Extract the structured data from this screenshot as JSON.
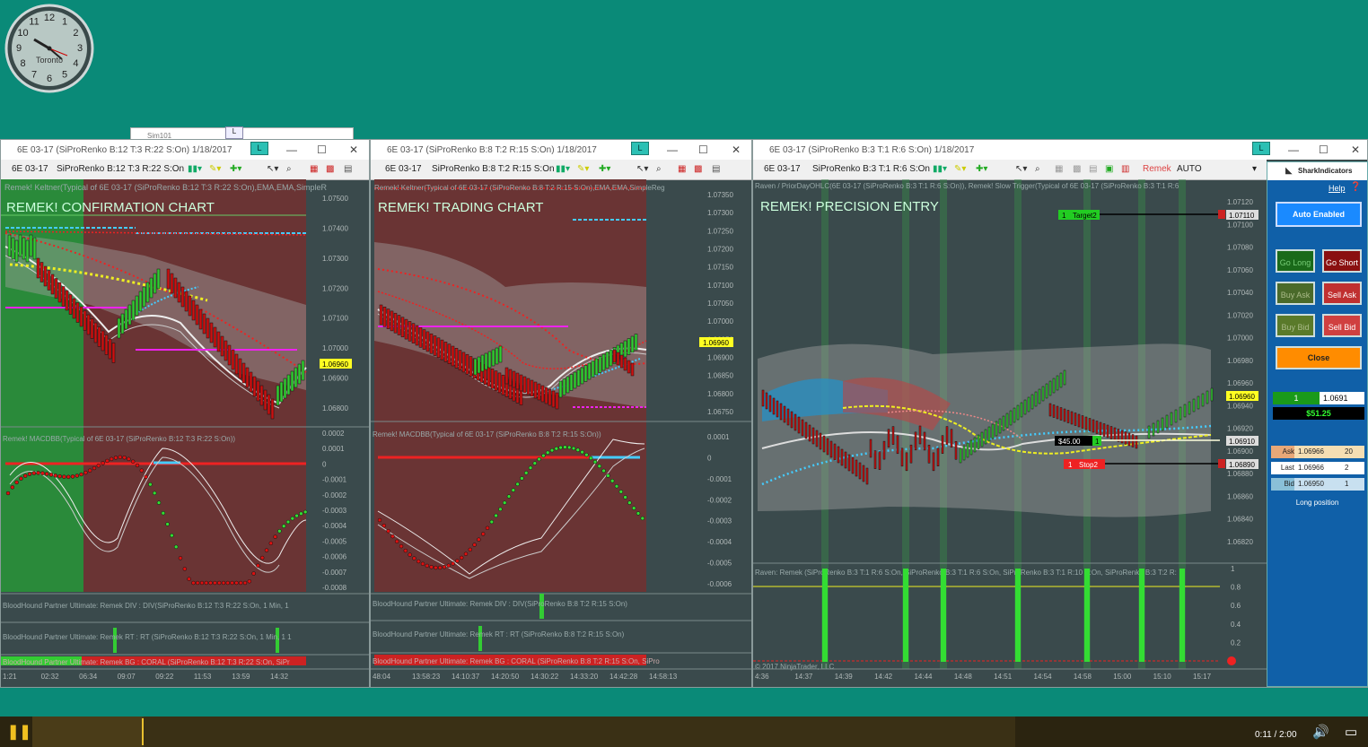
{
  "clock": {
    "city": "Toronto",
    "numerals": [
      "12",
      "1",
      "2",
      "3",
      "4",
      "5",
      "6",
      "7",
      "8",
      "9",
      "10",
      "11"
    ]
  },
  "behind_window": {
    "title": "Sim101",
    "l_label": "L"
  },
  "windows": [
    {
      "title": "6E 03-17 (SiProRenko B:12 T:3 R:22 S:On)  1/18/2017",
      "l_label": "L",
      "toolbar_instrument": "6E 03-17",
      "toolbar_bartype": "SiProRenko B:12 T:3 R:22 S:On",
      "indicator_top": "Remek! Keltner(Typical of 6E 03-17 (SiProRenko B:12 T:3 R:22 S:On),EMA,EMA,SimpleR",
      "chart_title": "REMEK! CONFIRMATION CHART",
      "price_labels": [
        "1.07500",
        "1.07400",
        "1.07300",
        "1.07200",
        "1.07100",
        "1.07000",
        "1.06900",
        "1.06800"
      ],
      "last_price": "1.06960",
      "macd_label": "Remek! MACDBB(Typical of 6E 03-17 (SiProRenko B:12 T:3 R:22 S:On))",
      "macd_labels": [
        "0.0002",
        "0.0001",
        "0",
        "-0.0001",
        "-0.0002",
        "-0.0003",
        "-0.0004",
        "-0.0005",
        "-0.0006",
        "-0.0007",
        "-0.0008"
      ],
      "div_label": "BloodHound Partner Ultimate: Remek DIV : DIV(SiProRenko B:12 T:3 R:22 S:On, 1 Min, 1",
      "rt_label": "BloodHound Partner Ultimate: Remek RT : RT (SiProRenko B:12 T:3 R:22 S:On, 1 Min, 1 1",
      "bg_label": "BloodHound Partner Ultimate: Remek BG : CORAL (SiProRenko B:12 T:3 R:22 S:On, SiPr",
      "times": [
        "1:21",
        "02:32",
        "06:34",
        "09:07",
        "09:22",
        "11:53",
        "13:59",
        "14:32"
      ]
    },
    {
      "title": "6E 03-17 (SiProRenko B:8 T:2 R:15 S:On)  1/18/2017",
      "l_label": "L",
      "toolbar_instrument": "6E 03-17",
      "toolbar_bartype": "SiProRenko B:8 T:2 R:15 S:On",
      "indicator_top": "Remek! Keltner(Typical of 6E 03-17 (SiProRenko B:8 T:2 R:15 S:On),EMA,EMA,SimpleReg",
      "chart_title": "REMEK! TRADING CHART",
      "price_labels": [
        "1.07350",
        "1.07300",
        "1.07250",
        "1.07200",
        "1.07150",
        "1.07100",
        "1.07050",
        "1.07000",
        "1.06950",
        "1.06900",
        "1.06850",
        "1.06800",
        "1.06750"
      ],
      "last_price": "1.06960",
      "macd_label": "Remek! MACDBB(Typical of 6E 03-17 (SiProRenko B:8 T:2 R:15 S:On))",
      "macd_labels": [
        "0.0001",
        "0",
        "-0.0001",
        "-0.0002",
        "-0.0003",
        "-0.0004",
        "-0.0005",
        "-0.0006"
      ],
      "div_label": "BloodHound Partner Ultimate: Remek DIV : DIV(SiProRenko B:8 T:2 R:15 S:On)",
      "rt_label": "BloodHound Partner Ultimate: Remek RT : RT (SiProRenko B:8 T:2 R:15 S:On)",
      "bg_label": "BloodHound Partner Ultimate: Remek BG : CORAL (SiProRenko B:8 T:2 R:15 S:On, SiPro",
      "times": [
        "48:04",
        "13:58:23",
        "14:10:37",
        "14:20:50",
        "14:30:22",
        "14:33:20",
        "14:42:28",
        "14:58:13"
      ]
    },
    {
      "title": "6E 03-17 (SiProRenko B:3 T:1 R:6 S:On)  1/18/2017",
      "l_label": "L",
      "toolbar_instrument": "6E 03-17",
      "toolbar_bartype": "SiProRenko B:3 T:1 R:6 S:On",
      "toolbar_remek": "Remek",
      "toolbar_auto": "AUTO",
      "indicator_top": "Raven / PriorDayOHLC(6E 03-17 (SiProRenko B:3 T:1 R:6 S:On)), Remek! Slow Trigger(Typical of 6E 03-17 (SiProRenko B:3 T:1 R:6",
      "chart_title": "REMEK! PRECISION ENTRY",
      "price_labels": [
        "1.07120",
        "1.07100",
        "1.07080",
        "1.07060",
        "1.07040",
        "1.07020",
        "1.07000",
        "1.06980",
        "1.06960",
        "1.06940",
        "1.06920",
        "1.06900",
        "1.06880",
        "1.06860",
        "1.06840",
        "1.06820"
      ],
      "target_label": "Target2",
      "target_qty": "1",
      "target_price": "1.07110",
      "stop_label": "Stop2",
      "stop_qty": "1",
      "stop_price": "1.06890",
      "pnl_tag": "$45.00",
      "pos_qty": "1",
      "entry_price": "1.06910",
      "last_price": "1.06960",
      "raven_label": "Raven: Remek (SiProRenko B:3 T:1 R:6 S:On, SiProRenko B:3 T:1 R:6 S:On, SiProRenko B:3 T:1 R:10 S:On, SiProRenko B:3 T:2 R:",
      "raven_labels": [
        "1",
        "0.8",
        "0.6",
        "0.4",
        "0.2",
        "0"
      ],
      "copyright": "© 2017 NinjaTrader, LLC",
      "times": [
        "4:36",
        "14:37",
        "14:39",
        "14:42",
        "14:44",
        "14:48",
        "14:51",
        "14:54",
        "14:58",
        "15:00",
        "15:10",
        "15:17"
      ]
    }
  ],
  "side": {
    "brand": "SharkIndicators",
    "help": "Help",
    "auto_enabled": "Auto Enabled",
    "go_long": "Go Long",
    "go_short": "Go Short",
    "buy_ask": "Buy Ask",
    "sell_ask": "Sell Ask",
    "buy_bid": "Buy Bid",
    "sell_bid": "Sell Bid",
    "close": "Close",
    "qty": "1",
    "price": "1.0691",
    "pnl": "$51.25",
    "ask_label": "Ask",
    "ask_price": "1.06966",
    "ask_size": "20",
    "last_label": "Last",
    "last_price": "1.06966",
    "last_size": "2",
    "bid_label": "Bid",
    "bid_price": "1.06950",
    "bid_size": "1",
    "position": "Long position"
  },
  "player": {
    "time": "0:11 / 2:00"
  },
  "colors": {
    "desktop": "#0a8a78",
    "up_bar": "#33cc33",
    "down_bar": "#cc1111",
    "panel": "#1060a8"
  }
}
